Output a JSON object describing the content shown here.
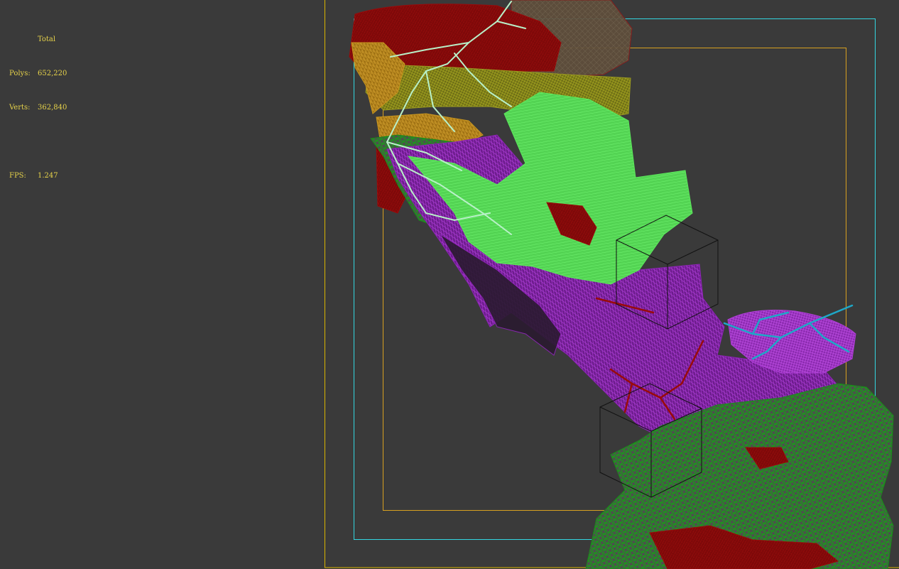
{
  "stats": {
    "header": "Total",
    "polys_label": "Polys:",
    "polys_value": "652,220",
    "verts_label": "Verts:",
    "verts_value": "362,840",
    "fps_label": "FPS:",
    "fps_value": "1.247"
  },
  "colors": {
    "background": "#3a3a3a",
    "stats_text": "#e6d24a",
    "safe_frame_outer": "#d8b400",
    "safe_frame_action": "#33d6e0",
    "safe_frame_title": "#d8a020",
    "mesh_red": "#9a0a0a",
    "mesh_olive": "#8a8a1a",
    "mesh_gold": "#c8961e",
    "mesh_light_green": "#5ce65c",
    "mesh_green": "#1a8a1a",
    "mesh_purple": "#8e24b8",
    "mesh_cyan": "#1ea8c8",
    "mesh_pale_green": "#b8f0c8"
  },
  "scene": {
    "gizmos": [
      "bounding-box-upper",
      "bounding-box-lower"
    ]
  }
}
